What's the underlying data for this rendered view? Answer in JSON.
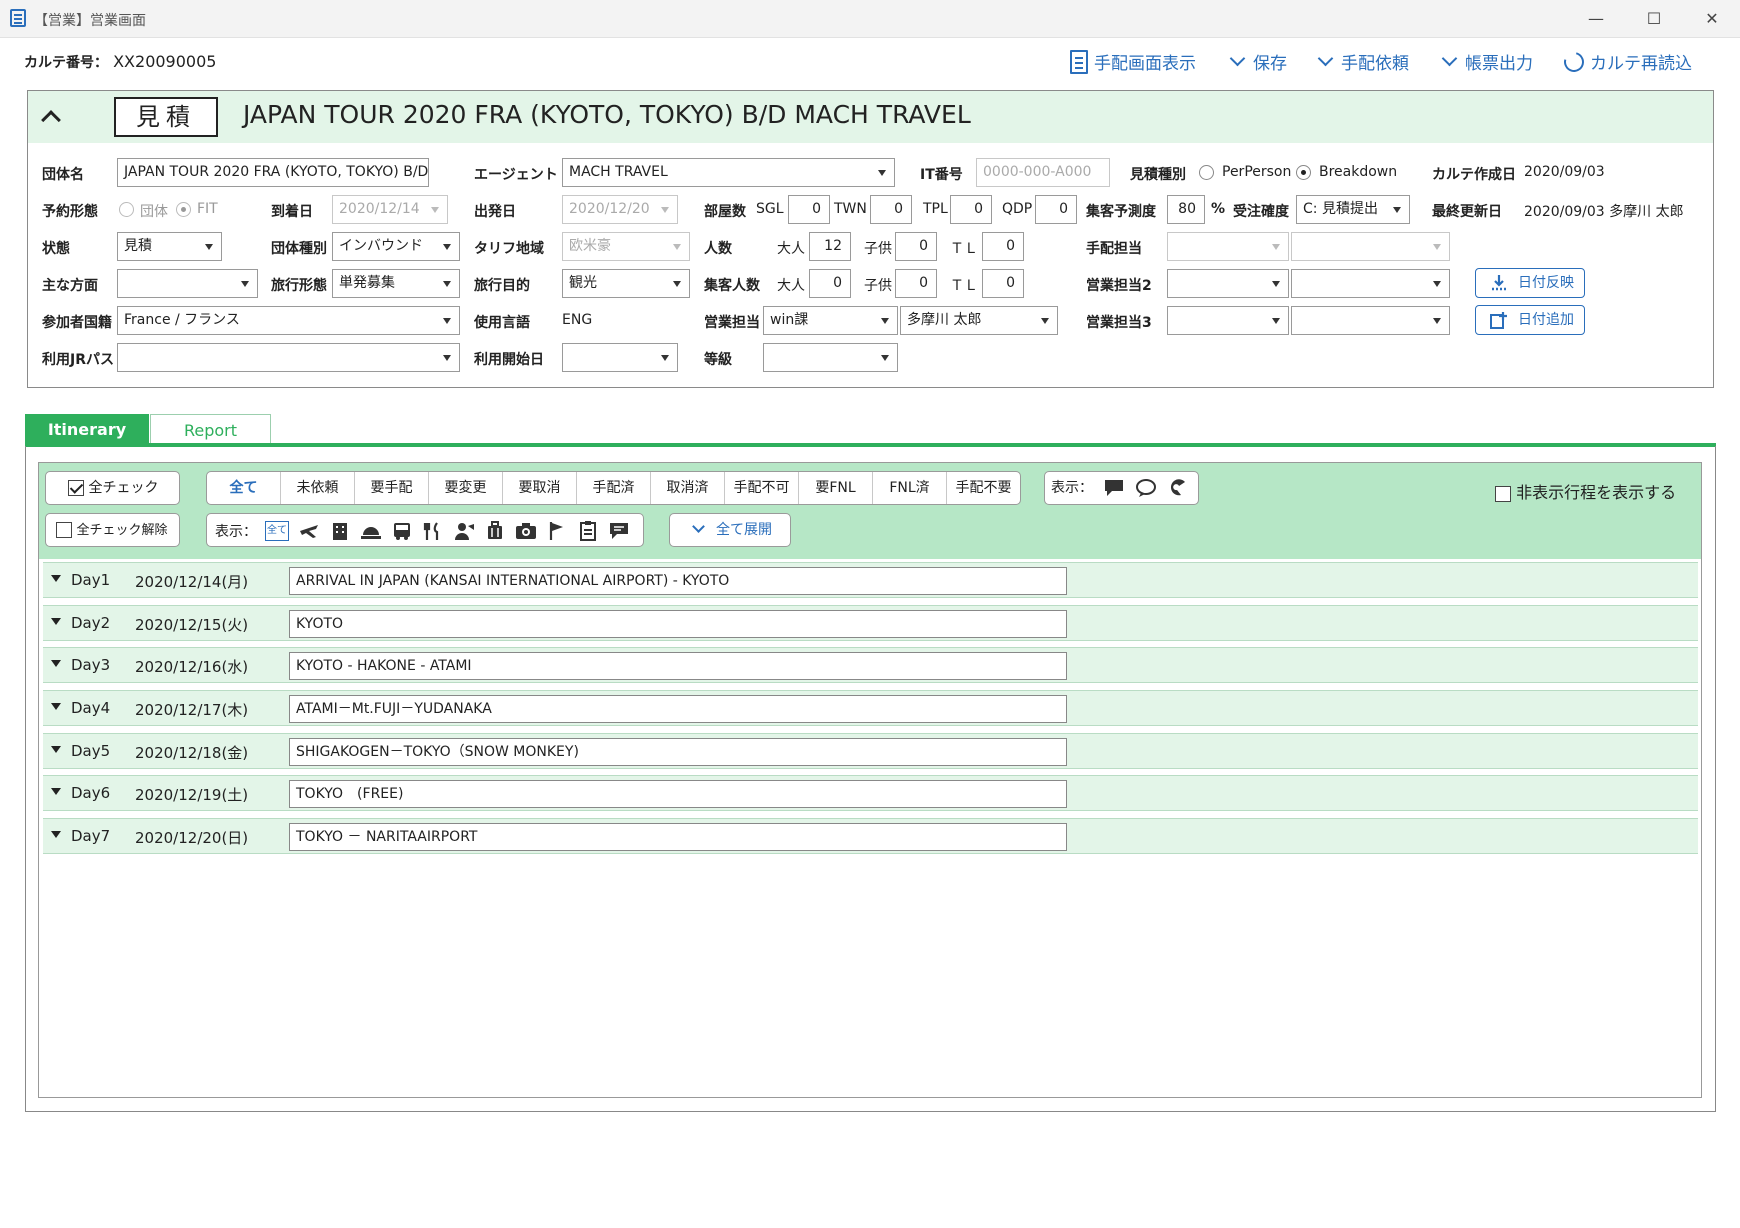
{
  "window": {
    "title": "【営業】営業画面",
    "minimize": "—",
    "maximize": "☐",
    "close": "✕"
  },
  "karte": {
    "label": "カルテ番号：",
    "value": "XX20090005"
  },
  "toolbar": {
    "arrange_view": "手配画面表示",
    "save": "保存",
    "arrange_request": "手配依頼",
    "form_output": "帳票出力",
    "reload": "カルテ再読込"
  },
  "header": {
    "status": "見積",
    "title": "JAPAN TOUR 2020 FRA (KYOTO, TOKYO) B/D  MACH TRAVEL"
  },
  "form": {
    "group_name_label": "団体名",
    "group_name": "JAPAN TOUR 2020 FRA (KYOTO, TOKYO) B/D",
    "agent_label": "エージェント",
    "agent": "MACH TRAVEL",
    "it_no_label": "IT番号",
    "it_no_placeholder": "0000-000-A000",
    "estimate_type_label": "見積種別",
    "estimate_perperson": "PerPerson",
    "estimate_breakdown": "Breakdown",
    "karte_created_label": "カルテ作成日",
    "karte_created": "2020/09/03",
    "booking_type_label": "予約形態",
    "booking_group": "団体",
    "booking_fit": "FIT",
    "arrival_label": "到着日",
    "arrival": "2020/12/14",
    "departure_label": "出発日",
    "departure": "2020/12/20",
    "rooms_label": "部屋数",
    "sgl_label": "SGL",
    "sgl": "0",
    "twn_label": "TWN",
    "twn": "0",
    "tpl_label": "TPL",
    "tpl": "0",
    "qdp_label": "QDP",
    "qdp": "0",
    "forecast_label": "集客予測度",
    "forecast": "80",
    "forecast_unit": "%",
    "order_label": "受注確度",
    "order": "C: 見積提出",
    "last_updated_label": "最終更新日",
    "last_updated": "2020/09/03 多摩川 太郎",
    "state_label": "状態",
    "state": "見積",
    "group_kind_label": "団体種別",
    "group_kind": "インバウンド",
    "tariff_label": "タリフ地域",
    "tariff": "欧米豪",
    "people_label": "人数",
    "adult_label": "大人",
    "adult": "12",
    "child_label": "子供",
    "child": "0",
    "tl_label": "ＴＬ",
    "tl": "0",
    "arrange_staff_label": "手配担当",
    "direction_label": "主な方面",
    "travel_form_label": "旅行形態",
    "travel_form": "単発募集",
    "purpose_label": "旅行目的",
    "purpose": "観光",
    "gather_label": "集客人数",
    "g_adult_label": "大人",
    "g_adult": "0",
    "g_child_label": "子供",
    "g_child": "0",
    "g_tl_label": "ＴＬ",
    "g_tl": "0",
    "sales2_label": "営業担当2",
    "date_reflect": "日付反映",
    "nationality_label": "参加者国籍",
    "nationality": "France / フランス",
    "language_label": "使用言語",
    "language": "ENG",
    "sales_label": "営業担当",
    "sales_section": "win課",
    "sales_person": "多摩川 太郎",
    "sales3_label": "営業担当3",
    "date_add": "日付追加",
    "jrpass_label": "利用JRパス",
    "start_date_label": "利用開始日",
    "grade_label": "等級"
  },
  "tabs": {
    "itinerary": "Itinerary",
    "report": "Report"
  },
  "filters": {
    "check_all": "全チェック",
    "uncheck_all": "全チェック解除",
    "status_segments": [
      "全て",
      "未依頼",
      "要手配",
      "要変更",
      "要取消",
      "手配済",
      "取消済",
      "手配不可",
      "要FNL",
      "FNL済",
      "手配不要"
    ],
    "display_label": "表示：",
    "display_label2": "表示：",
    "all_icon_label": "全て",
    "expand_all": "全て展開",
    "show_hidden": "非表示行程を表示する",
    "category_icons": [
      "plane-icon",
      "hotel-icon",
      "meal-dome-icon",
      "bus-icon",
      "restaurant-icon",
      "guide-icon",
      "luggage-icon",
      "camera-icon",
      "flag-icon",
      "document-icon",
      "chat-icon"
    ]
  },
  "days": [
    {
      "num": "Day1",
      "date": "2020/12/14(月)",
      "title": "ARRIVAL IN JAPAN (KANSAI INTERNATIONAL AIRPORT) - KYOTO"
    },
    {
      "num": "Day2",
      "date": "2020/12/15(火)",
      "title": "KYOTO"
    },
    {
      "num": "Day3",
      "date": "2020/12/16(水)",
      "title": "KYOTO - HAKONE - ATAMI"
    },
    {
      "num": "Day4",
      "date": "2020/12/17(木)",
      "title": "ATAMI－Mt.FUJI－YUDANAKA"
    },
    {
      "num": "Day5",
      "date": "2020/12/18(金)",
      "title": "SHIGAKOGEN－TOKYO（SNOW MONKEY)"
    },
    {
      "num": "Day6",
      "date": "2020/12/19(土)",
      "title": "TOKYO　(FREE)"
    },
    {
      "num": "Day7",
      "date": "2020/12/20(日)",
      "title": "TOKYO － NARITAAIRPORT"
    }
  ]
}
